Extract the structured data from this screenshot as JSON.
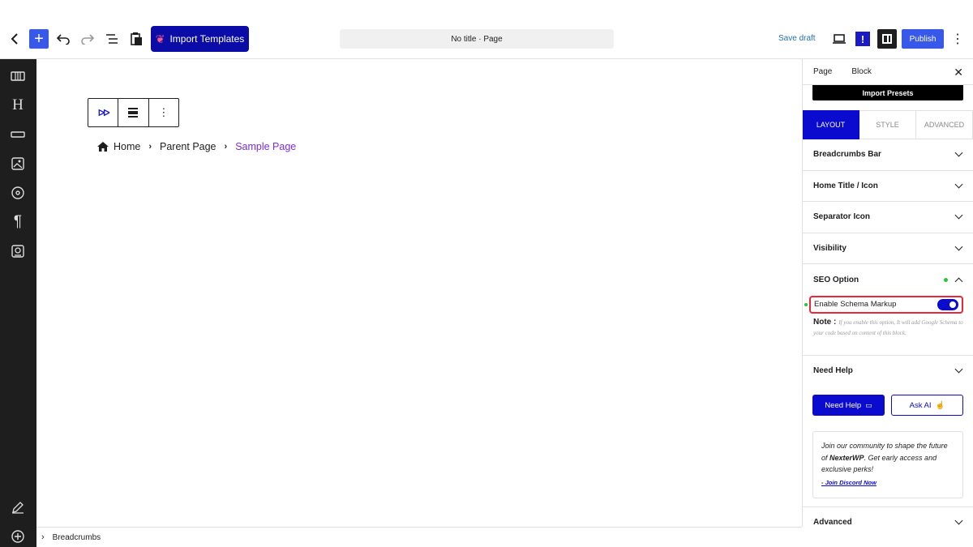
{
  "topbar": {
    "import_templates_label": "Import Templates",
    "doc_title": "No title · Page",
    "save_draft_label": "Save draft",
    "publish_label": "Publish",
    "exclamation": "!"
  },
  "block_toolbar": {
    "logo_text": "ᐅᐅ"
  },
  "breadcrumbs": {
    "home": "Home",
    "parent": "Parent Page",
    "current": "Sample Page",
    "separator": "›"
  },
  "bottombar": {
    "path": "Breadcrumbs"
  },
  "panel": {
    "tabs": [
      {
        "label": "Page"
      },
      {
        "label": "Block"
      }
    ],
    "import_presets_label": "Import Presets",
    "mode_tabs": [
      {
        "label": "LAYOUT"
      },
      {
        "label": "STYLE"
      },
      {
        "label": "ADVANCED"
      }
    ],
    "sections": [
      {
        "label": "Breadcrumbs Bar"
      },
      {
        "label": "Home Title / Icon"
      },
      {
        "label": "Separator Icon"
      },
      {
        "label": "Visibility"
      }
    ],
    "seo": {
      "label": "SEO Option",
      "schema_label": "Enable Schema Markup",
      "schema_enabled": true,
      "note_label": "Note :",
      "note_text": "If you enable this option, It will add Google Schema to your code based on content of this block."
    },
    "need_help": {
      "label": "Need Help",
      "help_button": "Need Help",
      "ai_button": "Ask AI"
    },
    "community": {
      "text_before": "Join our community to shape the future of ",
      "brand": "NexterWP",
      "text_after": ". Get early access and exclusive perks!",
      "link": "- Join Discord Now"
    },
    "advanced_label": "Advanced"
  },
  "colors": {
    "primary": "#0b0bd0",
    "wp_blue": "#3858e9",
    "highlight": "#e8273d",
    "current_crumb": "#7b2ce6",
    "status_dot": "#21c93a"
  }
}
